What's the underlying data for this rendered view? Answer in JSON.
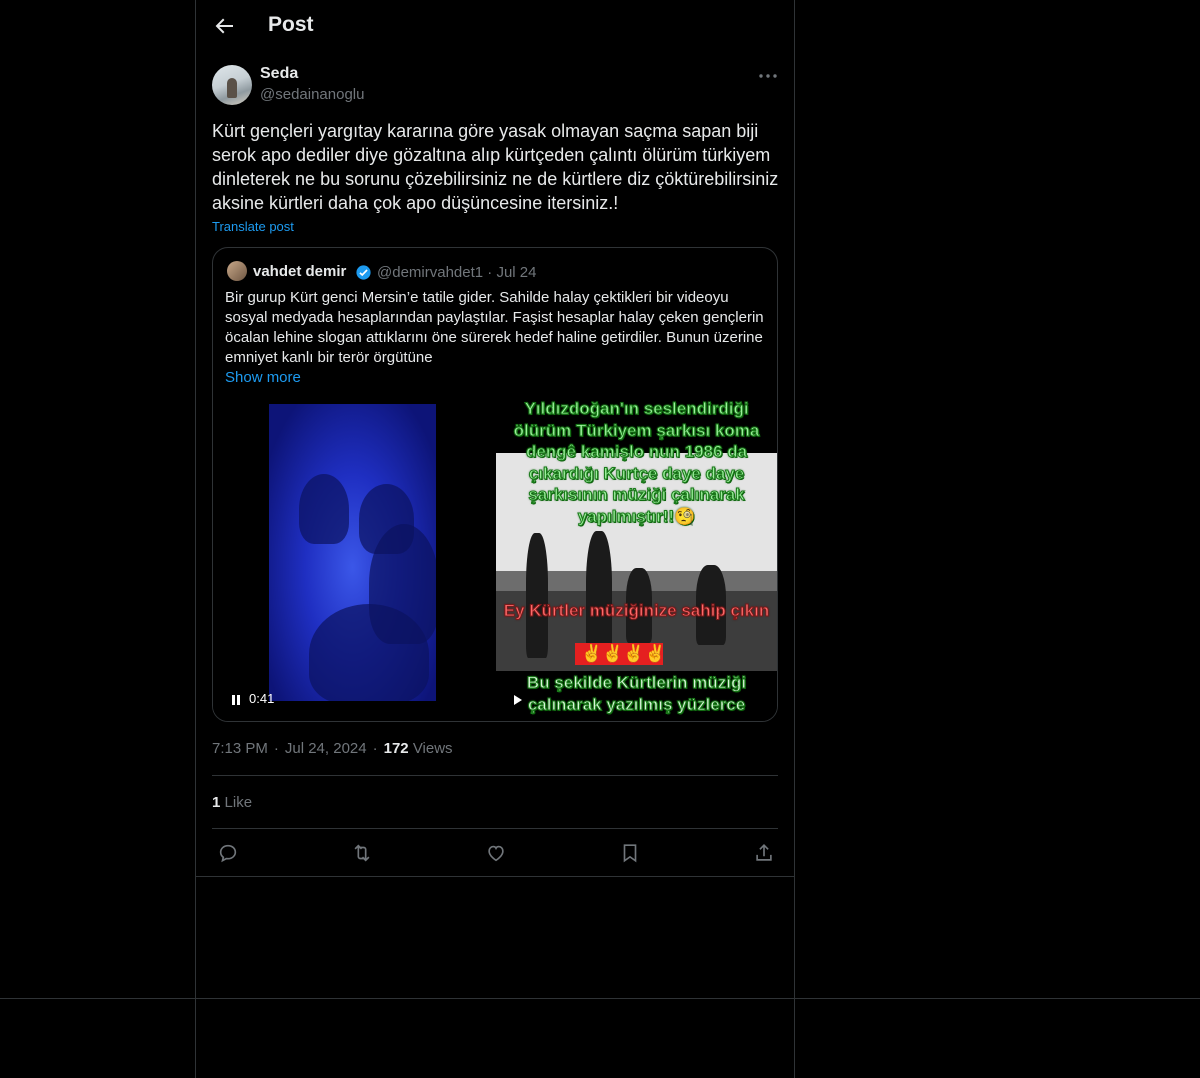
{
  "header": {
    "title": "Post"
  },
  "author": {
    "name": "Seda",
    "handle": "@sedainanoglu"
  },
  "post": {
    "text": "Kürt gençleri yargıtay kararına göre yasak olmayan saçma sapan biji serok apo dediler diye gözaltına alıp kürtçeden çalıntı ölürüm türkiyem dinleterek ne bu sorunu çözebilirsiniz ne de kürtlere diz çöktürebilirsiniz aksine kürtleri daha çok apo düşüncesine itersiniz.!",
    "translate_label": "Translate post"
  },
  "quote": {
    "name": "vahdet demir",
    "handle_date": "@demirvahdet1 · Jul 24",
    "text": "Bir gurup Kürt genci Mersin’e tatile gider. Sahilde halay çektikleri bir videoyu sosyal medyada hesaplarından paylaştılar. Faşist hesaplar halay çeken gençlerin öcalan lehine slogan attıklarını öne sürerek hedef haline getirdiler. Bunun üzerine emniyet kanlı bir terör örgütüne",
    "show_more": "Show more",
    "video1_time": "0:41",
    "video2_text_top": "Yıldızdoğan'ın seslendirdiği ölürüm Türkiyem şarkısı koma dengê kamişlo nun 1986 da çıkardığı Kurtçe daye daye şarkısının müziği çalınarak yapılmıştır!!🧐",
    "video2_text_mid": "Ey Kürtler müziğinize sahip çıkın",
    "video2_hands": "✌️✌️✌️✌️",
    "video2_text_bottom": "Bu şekilde Kürtlerin müziği çalınarak yazılmış yüzlerce"
  },
  "meta": {
    "time": "7:13 PM",
    "date": "Jul 24, 2024",
    "views_count": "172",
    "views_label": "Views"
  },
  "engagement": {
    "likes_count": "1",
    "likes_label": "Like"
  },
  "colors": {
    "background": "#000000",
    "border": "#2f3336",
    "accent": "#1d9bf0",
    "muted": "#71767b",
    "text": "#e7e9ea"
  },
  "icons": [
    "back-arrow-icon",
    "more-icon",
    "verified-badge-icon",
    "pause-icon",
    "play-icon",
    "reply-icon",
    "retweet-icon",
    "like-icon",
    "bookmark-icon",
    "share-icon"
  ]
}
